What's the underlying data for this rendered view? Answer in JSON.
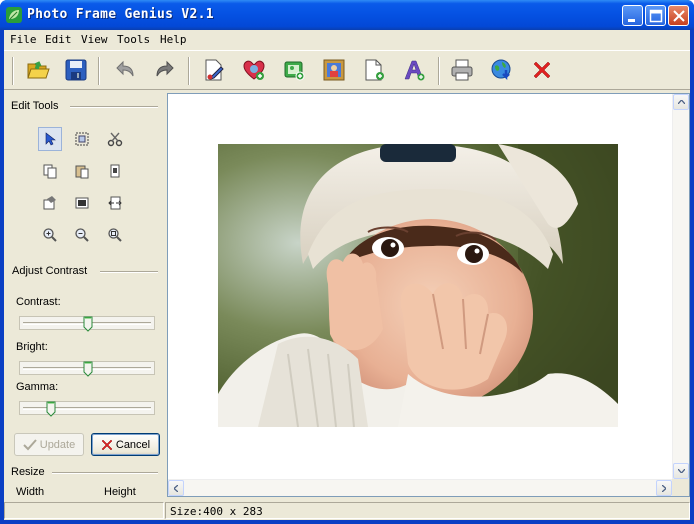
{
  "window": {
    "title": "Photo Frame Genius V2.1",
    "title_color": "#0551e2"
  },
  "menu": [
    {
      "label": "File"
    },
    {
      "label": "Edit"
    },
    {
      "label": "View"
    },
    {
      "label": "Tools"
    },
    {
      "label": "Help"
    }
  ],
  "toolbar": {
    "icons": [
      "open-folder-icon",
      "save-icon",
      "undo-icon",
      "redo-icon",
      "edit-document-icon",
      "heart-frame-icon",
      "add-image-icon",
      "picture-frame-icon",
      "new-page-icon",
      "add-text-icon",
      "print-icon",
      "web-update-icon",
      "delete-icon"
    ]
  },
  "edit_tools": {
    "label": "Edit Tools",
    "icons": [
      "pointer-icon",
      "select-rect-icon",
      "cut-icon",
      "copy-icon",
      "paste-icon",
      "crop-icon",
      "rotate-icon",
      "flip-icon",
      "resize-icon",
      "zoom-in-icon",
      "zoom-out-icon",
      "zoom-fit-icon"
    ]
  },
  "adjust": {
    "label": "Adjust Contrast",
    "contrast_label": "Contrast:",
    "bright_label": "Bright:",
    "gamma_label": "Gamma:",
    "contrast_value": 0.5,
    "bright_value": 0.5,
    "gamma_value": 0.2,
    "update_label": "Update",
    "cancel_label": "Cancel"
  },
  "resize": {
    "label": "Resize",
    "width_label": "Width",
    "height_label": "Height"
  },
  "status": {
    "size_text": "Size:400 x 283"
  }
}
